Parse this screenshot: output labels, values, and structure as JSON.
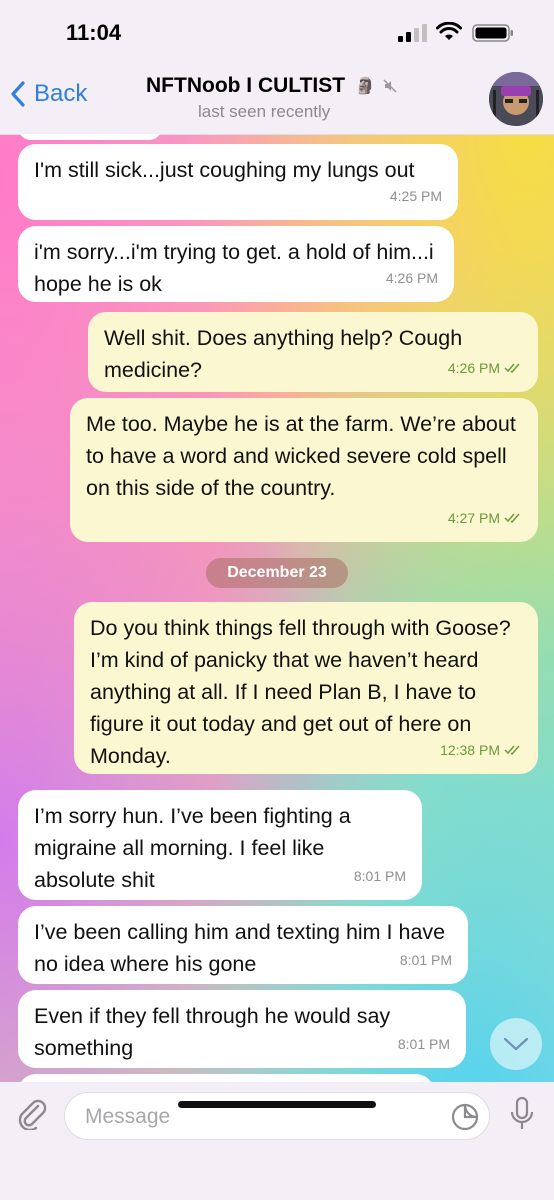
{
  "status_bar": {
    "time": "11:04"
  },
  "header": {
    "back_label": "Back",
    "title": "NFTNoob I CULTIST",
    "title_emoji": "🗿",
    "subtitle": "last seen recently"
  },
  "messages": [
    {
      "dir": "in",
      "text": "I'm still sick...just coughing my lungs out",
      "time": "4:25 PM"
    },
    {
      "dir": "in",
      "text": "i'm sorry...i'm trying to get. a hold of him...i hope he is ok",
      "time": "4:26 PM"
    },
    {
      "dir": "out",
      "text": "Well shit. Does anything help? Cough medicine?",
      "time": "4:26 PM"
    },
    {
      "dir": "out",
      "text": "Me too. Maybe he is at the farm. We’re about to have a word and wicked severe cold spell on this side of the country.",
      "time": "4:27 PM"
    },
    {
      "dir": "out",
      "text": "Do you think things fell through with Goose? I’m kind of panicky that we haven’t heard anything at all. If I need Plan B, I have to figure it out today and get out of here on Monday.",
      "time": "12:38 PM"
    },
    {
      "dir": "in",
      "text": "I’m sorry hun. I’ve been fighting a migraine all morning. I feel like absolute shit",
      "time": "8:01 PM"
    },
    {
      "dir": "in",
      "text": "I’ve been calling him and texting him I have no idea where his gone",
      "time": "8:01 PM"
    },
    {
      "dir": "in",
      "text": "Even if they fell through he would say something",
      "time": "8:01 PM"
    }
  ],
  "date_separator": "December 23",
  "composer": {
    "placeholder": "Message"
  },
  "colors": {
    "accent": "#2f7fde",
    "outgoing_bubble": "#fbf8d1",
    "incoming_bubble": "#ffffff",
    "read_check": "#6a9a3a"
  }
}
